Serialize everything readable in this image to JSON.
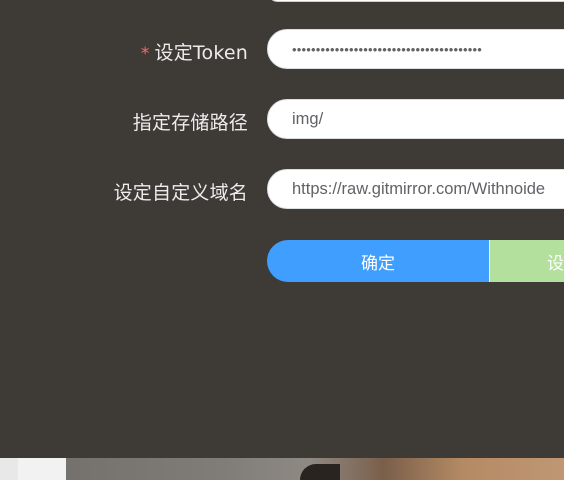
{
  "form": {
    "token": {
      "label": "设定Token",
      "required_mark": "*",
      "value": "••••••••••••••••••••••••••••••••••••••••"
    },
    "storage_path": {
      "label": "指定存储路径",
      "value": "img/"
    },
    "custom_domain": {
      "label": "设定自定义域名",
      "value": "https://raw.gitmirror.com/Withnoide"
    }
  },
  "buttons": {
    "confirm_label": "确定",
    "second_label": "设"
  },
  "colors": {
    "panel_bg": "#3e3b37",
    "primary": "#409eff",
    "success_light": "#b3e19d",
    "required": "#f56c6c"
  }
}
